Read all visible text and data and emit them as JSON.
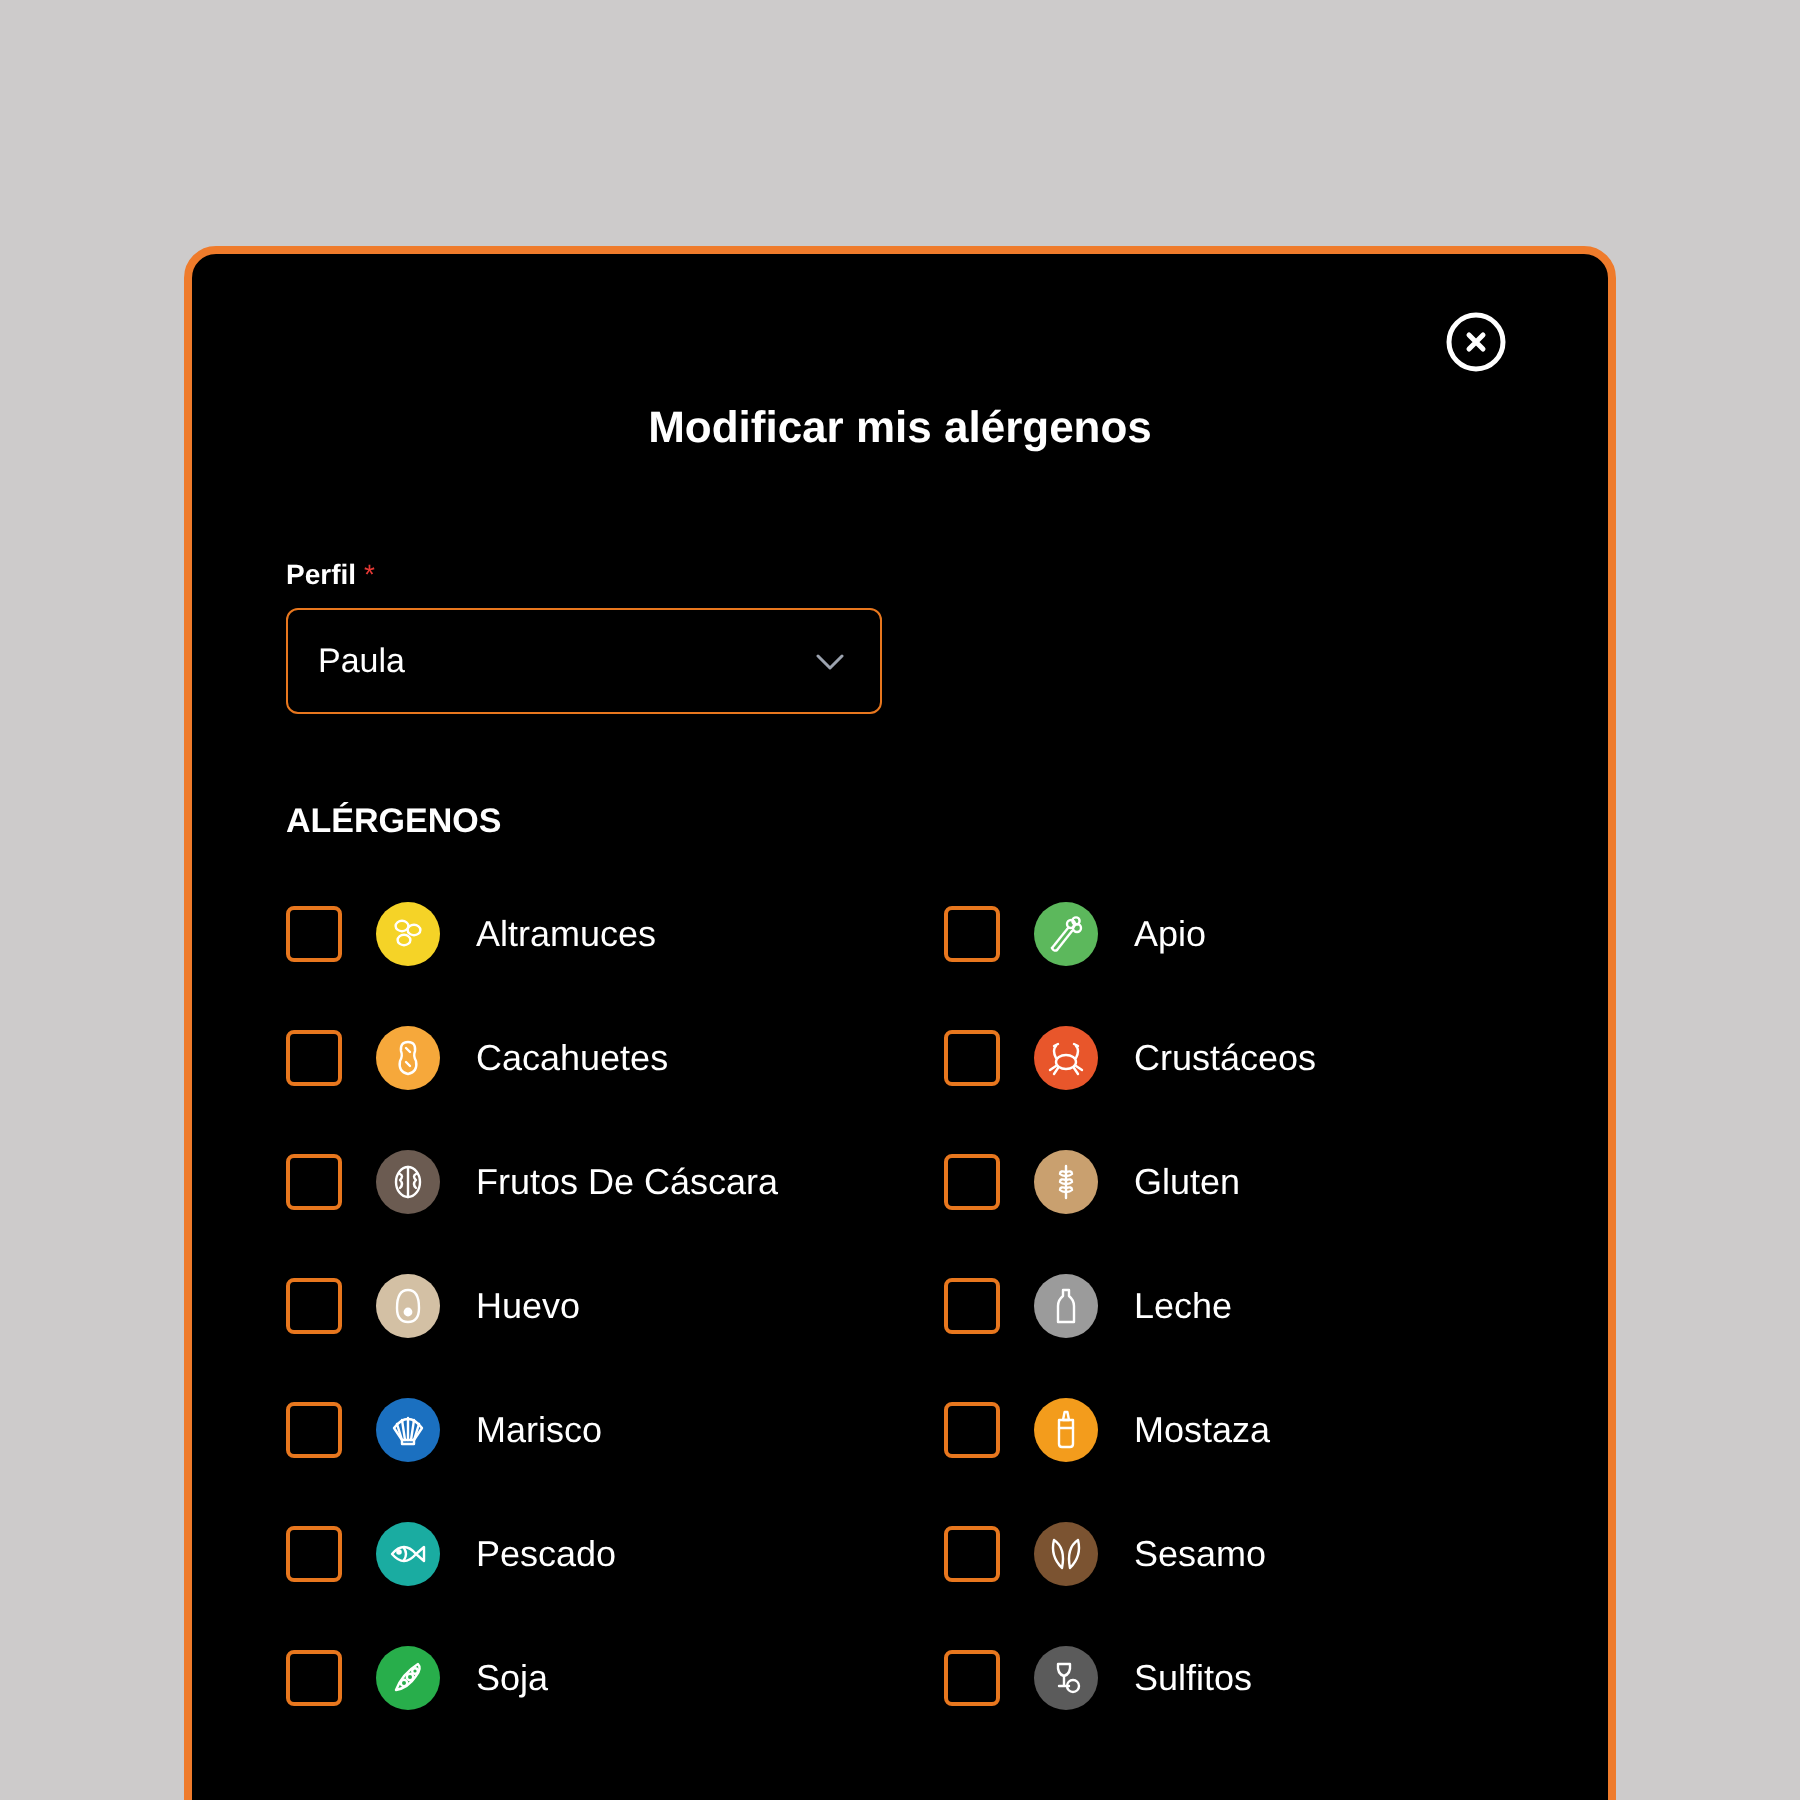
{
  "title": "Modificar mis alérgenos",
  "profile": {
    "label": "Perfil",
    "required_mark": "*",
    "value": "Paula"
  },
  "allergens_heading": "ALÉRGENOS",
  "allergens": [
    {
      "name": "Altramuces",
      "color": "#f5d327",
      "checked": false
    },
    {
      "name": "Apio",
      "color": "#5cb85c",
      "checked": false
    },
    {
      "name": "Cacahuetes",
      "color": "#f6a83b",
      "checked": false
    },
    {
      "name": "Crustáceos",
      "color": "#e8562b",
      "checked": false
    },
    {
      "name": "Frutos De Cáscara",
      "color": "#6b5b51",
      "checked": false
    },
    {
      "name": "Gluten",
      "color": "#c9a06f",
      "checked": false
    },
    {
      "name": "Huevo",
      "color": "#d3c0a4",
      "checked": false
    },
    {
      "name": "Leche",
      "color": "#9b9b9b",
      "checked": false
    },
    {
      "name": "Marisco",
      "color": "#1b70c0",
      "checked": false
    },
    {
      "name": "Mostaza",
      "color": "#f39c1c",
      "checked": false
    },
    {
      "name": "Pescado",
      "color": "#1aaca1",
      "checked": false
    },
    {
      "name": "Sesamo",
      "color": "#7b5331",
      "checked": false
    },
    {
      "name": "Soja",
      "color": "#28ae4b",
      "checked": false
    },
    {
      "name": "Sulfitos",
      "color": "#5b5b5b",
      "checked": false
    }
  ]
}
